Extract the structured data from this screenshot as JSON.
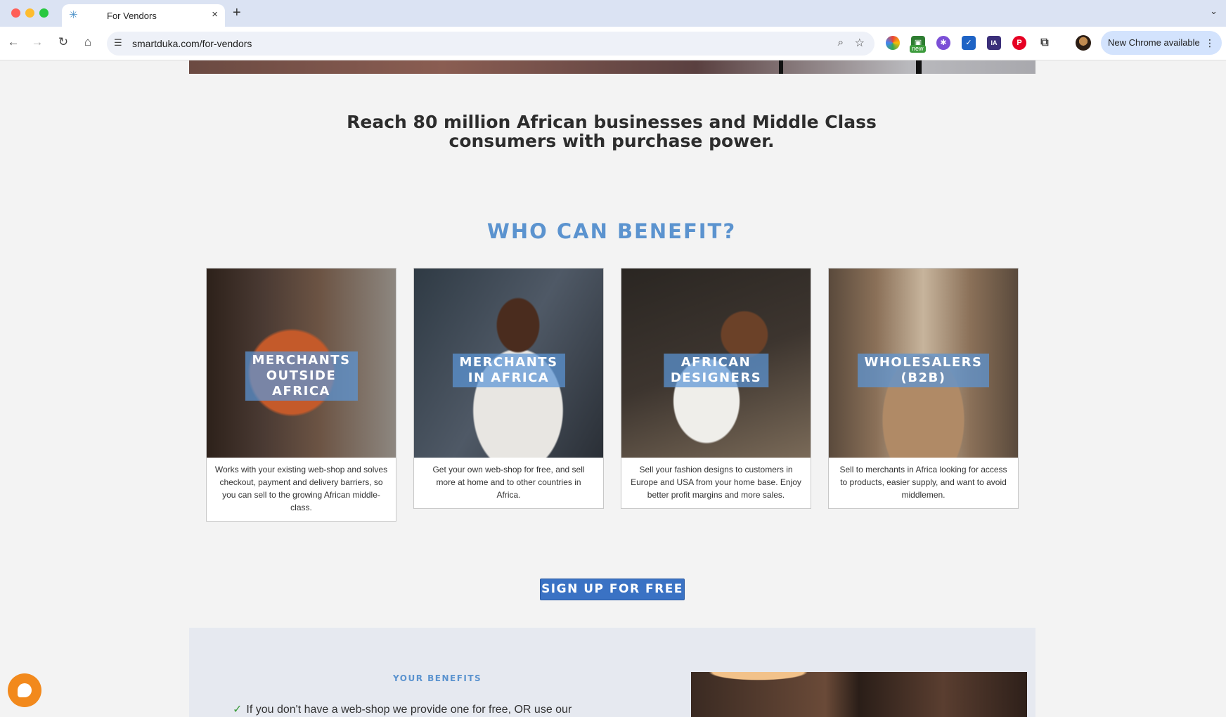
{
  "browser": {
    "tab_title": "For Vendors",
    "tab_favicon": "✳",
    "url": "smartduka.com/for-vendors",
    "update_label": "New Chrome available",
    "ext_new_badge": "new",
    "ext_ia_label": "IA"
  },
  "page": {
    "headline": "Reach 80 million African businesses and Middle Class consumers with purchase power.",
    "section_title": "WHO CAN BENEFIT?",
    "cards": [
      {
        "label": "MERCHANTS\nOUTSIDE\nAFRICA",
        "description": "Works with your existing web-shop and solves\ncheckout, payment and delivery barriers, so\nyou can sell to the growing African middle-\nclass."
      },
      {
        "label": "MERCHANTS\nIN AFRICA",
        "description": "Get your own web-shop for free, and sell\nmore at home and to other countries in\nAfrica."
      },
      {
        "label": "AFRICAN\nDESIGNERS",
        "description": "Sell your fashion designs to customers in\nEurope and USA from your home base. Enjoy\nbetter profit margins and more sales."
      },
      {
        "label": "WHOLESALERS\n(B2B)",
        "description": "Sell to merchants in Africa looking for access\nto products, easier supply, and want to avoid\nmiddlemen."
      }
    ],
    "signup_label": "SIGN UP FOR FREE",
    "benefits_title": "YOUR BENEFITS",
    "benefit_line": "If you don't have a web-shop we provide one for free, OR use our"
  },
  "icons": {
    "favicon": "snowflake-icon",
    "close": "close-icon",
    "chat": "chat-icon"
  }
}
